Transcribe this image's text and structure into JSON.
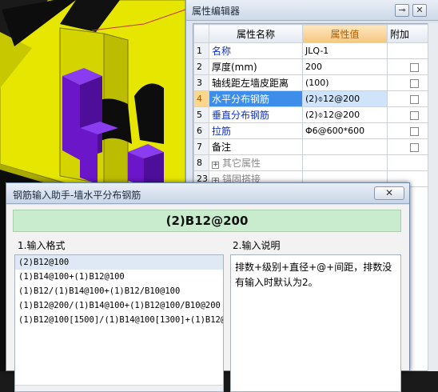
{
  "property_editor": {
    "title": "属性编辑器",
    "pin_glyph": "⊸",
    "close_glyph": "✕",
    "columns": {
      "index": "",
      "name": "属性名称",
      "value": "属性值",
      "attach": "附加"
    },
    "rows": [
      {
        "num": "1",
        "name": "名称",
        "value": "JLQ-1",
        "attach": false,
        "style": "blue",
        "selected": false
      },
      {
        "num": "2",
        "name": "厚度(mm)",
        "value": "200",
        "attach": true,
        "style": "black",
        "selected": false
      },
      {
        "num": "3",
        "name": "轴线距左墙皮距离",
        "value": "(100)",
        "attach": true,
        "style": "black",
        "selected": false
      },
      {
        "num": "4",
        "name": "水平分布钢筋",
        "value": "(2)⌽12@200",
        "attach": true,
        "style": "blue",
        "selected": true
      },
      {
        "num": "5",
        "name": "垂直分布钢筋",
        "value": "(2)⌽12@200",
        "attach": true,
        "style": "blue",
        "selected": false
      },
      {
        "num": "6",
        "name": "拉筋",
        "value": "Φ6@600*600",
        "attach": true,
        "style": "blue",
        "selected": false
      },
      {
        "num": "7",
        "name": "备注",
        "value": "",
        "attach": true,
        "style": "black",
        "selected": false
      },
      {
        "num": "8",
        "name": "其它属性",
        "value": "",
        "attach": false,
        "style": "grey",
        "selected": false,
        "expander": "+"
      },
      {
        "num": "23",
        "name": "锚固搭接",
        "value": "",
        "attach": false,
        "style": "grey",
        "selected": false,
        "expander": "+"
      }
    ]
  },
  "rebar_dialog": {
    "title": "钢筋输入助手-墙水平分布钢筋",
    "close_glyph": "✕",
    "formula": "(2)B12@200",
    "format_label": "1.输入格式",
    "desc_label": "2.输入说明",
    "formats": [
      "(2)B12@100",
      "(1)B14@100+(1)B12@100",
      "(1)B12/(1)B14@100+(1)B12/B10@100",
      "(1)B12@200/(1)B14@100+(1)B12@100/B10@200",
      "(1)B12@100[1500]/(1)B14@100[1300]+(1)B12@"
    ],
    "selected_format_index": 0,
    "description": "排数+级别+直径+@+间距，排数没有输入时默认为2。"
  },
  "colors": {
    "wall_yellow": "#e6e600",
    "column_purple": "#6b16c8",
    "formula_bg": "#c9eccf",
    "selected_name_bg": "#3d8eea",
    "header_value_bg": "#f6c77f"
  }
}
